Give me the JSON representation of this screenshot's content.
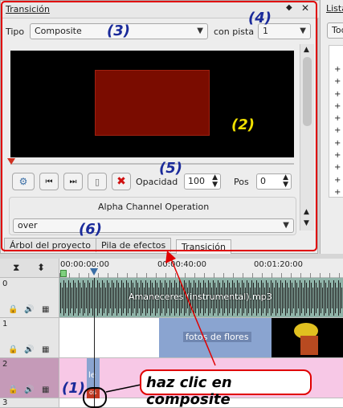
{
  "panel": {
    "title": "Transición",
    "title_buttons": [
      "◆",
      "✕"
    ],
    "type_label": "Tipo",
    "type_value": "Composite",
    "track_label": "con pista",
    "track_value": "1",
    "opacity_label": "Opacidad",
    "opacity_value": "100",
    "pos_label": "Pos",
    "pos_value": "0",
    "section_title": "Alpha Channel Operation",
    "alpha_value": "over",
    "tabs": [
      "Árbol del proyecto",
      "Pila de efectos",
      "Transición"
    ]
  },
  "right_panel": {
    "title": "Lista",
    "combo_value": "Tod",
    "tree_items": [
      "+",
      "+",
      "+",
      "+",
      "+",
      "+",
      "+",
      "+",
      "+",
      "+",
      "+"
    ]
  },
  "annotations": {
    "n1": "(1)",
    "n2": "(2)",
    "n3": "(3)",
    "n4": "(4)",
    "n5": "(5)",
    "n6": "(6)",
    "callout": "haz clic en composite"
  },
  "timeline": {
    "ruler": [
      "00:00:00:00",
      "00:00:40:00",
      "00:01:20:00"
    ],
    "tracks": [
      {
        "num": "0",
        "clip": "Amaneceres (instrumental).mp3"
      },
      {
        "num": "1",
        "clip": "fotos de flores"
      },
      {
        "num": "2",
        "clip": "le"
      },
      {
        "num": "3",
        "clip": ""
      }
    ],
    "transition_label": "os"
  },
  "colors": {
    "highlight_red": "#e00000",
    "annotation_blue": "#1a2a9a",
    "annotation_yellow": "#f0e000",
    "audio_clip": "#8fb3a8",
    "video_clip": "#8aa4d0",
    "track2_bg": "#f7c8e6"
  }
}
